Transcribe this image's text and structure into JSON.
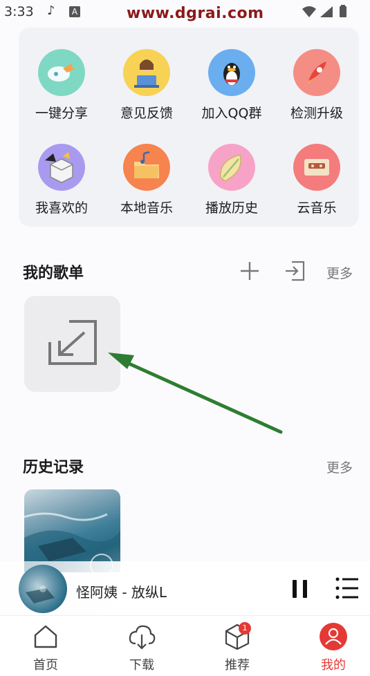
{
  "status_bar": {
    "time": "3:33",
    "watermark": "www.dgrai.com",
    "icons": [
      "music-note-icon",
      "notification-a-icon",
      "wifi-icon",
      "signal-icon",
      "battery-icon"
    ]
  },
  "quick_actions": [
    {
      "label": "一键分享",
      "icon": "share-icon",
      "color": "#7fd8c4"
    },
    {
      "label": "意见反馈",
      "icon": "feedback-icon",
      "color": "#f7d255"
    },
    {
      "label": "加入QQ群",
      "icon": "qq-penguin-icon",
      "color": "#6aaef0"
    },
    {
      "label": "检测升级",
      "icon": "upgrade-icon",
      "color": "#f48e85"
    },
    {
      "label": "我喜欢的",
      "icon": "favorites-box-icon",
      "color": "#a99af0"
    },
    {
      "label": "本地音乐",
      "icon": "local-folder-icon",
      "color": "#f7834f"
    },
    {
      "label": "播放历史",
      "icon": "history-leaf-icon",
      "color": "#f7a3c7"
    },
    {
      "label": "云音乐",
      "icon": "cloud-cassette-icon",
      "color": "#f47c7c"
    }
  ],
  "playlist_section": {
    "title": "我的歌单",
    "add_icon": "plus-icon",
    "import_icon": "import-icon",
    "more": "更多",
    "import_card_icon": "import-arrow-icon"
  },
  "history_section": {
    "title": "历史记录",
    "more": "更多"
  },
  "mini_player": {
    "title": "怪阿姨 - 放纵L",
    "pause_icon": "pause-icon",
    "queue_icon": "playlist-queue-icon"
  },
  "bottom_nav": [
    {
      "label": "首页",
      "icon": "home-icon",
      "active": false
    },
    {
      "label": "下载",
      "icon": "cloud-download-icon",
      "active": false
    },
    {
      "label": "推荐",
      "icon": "cube-icon",
      "active": false,
      "badge": "1"
    },
    {
      "label": "我的",
      "icon": "user-icon",
      "active": true
    }
  ],
  "colors": {
    "accent": "#e53935",
    "annotation_arrow": "#2e7d32"
  }
}
